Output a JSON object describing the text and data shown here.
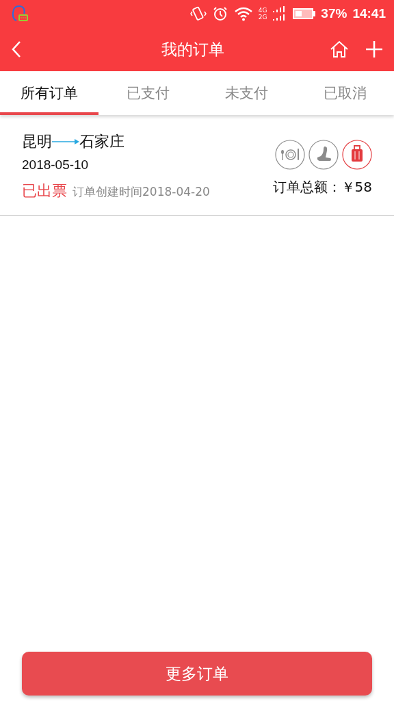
{
  "status_bar": {
    "network_top": "4G",
    "network_bottom": "2G",
    "battery_percent": "37%",
    "time": "14:41"
  },
  "header": {
    "title": "我的订单"
  },
  "tabs": [
    {
      "label": "所有订单",
      "selected": true
    },
    {
      "label": "已支付",
      "selected": false
    },
    {
      "label": "未支付",
      "selected": false
    },
    {
      "label": "已取消",
      "selected": false
    }
  ],
  "orders": [
    {
      "from": "昆明",
      "to": "石家庄",
      "date": "2018-05-10",
      "status": "已出票",
      "created": "订单创建时间2018-04-20",
      "total_label": "订单总额：",
      "total": "￥58",
      "services": [
        {
          "kind": "meal",
          "on": false
        },
        {
          "kind": "seat",
          "on": false
        },
        {
          "kind": "luggage",
          "on": true
        }
      ]
    }
  ],
  "more_button": "更多订单"
}
